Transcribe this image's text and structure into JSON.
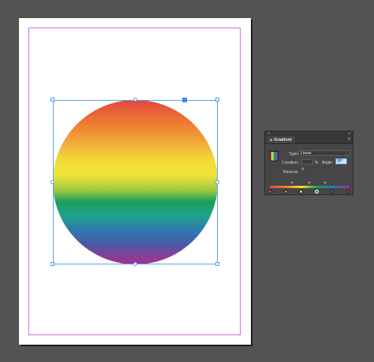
{
  "canvas": {
    "margin_guide_color": "#d26cf0",
    "selection_color": "#5aa2e6",
    "object": {
      "shape": "circle",
      "fill": "linear-gradient",
      "colors": [
        "#e2473d",
        "#ec7a34",
        "#f3e035",
        "#9ccb41",
        "#1a9d5d",
        "#2f76b0",
        "#993591"
      ]
    }
  },
  "gradient_panel": {
    "close_glyph": "×",
    "collapse_glyph": "»",
    "tab_label": "Gradient",
    "tab_glyph": "◆",
    "menu_glyph": "≡",
    "type_label": "Type:",
    "type_value": "Linear",
    "type_chevron": "⌄",
    "location_label": "Location:",
    "location_value": "",
    "percent_label": "%",
    "angle_label": "Angle:",
    "angle_value": "90°",
    "reverse_label": "Reverse",
    "reverse_glyph": "⇅",
    "stops": [
      "#e2473d",
      "#ec7a34",
      "#f3e035",
      "#1a9d5d",
      "#2f76b0",
      "#993591"
    ],
    "active_stop_index": 3
  }
}
